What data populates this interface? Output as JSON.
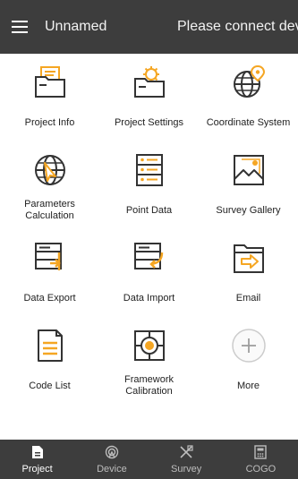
{
  "header": {
    "title": "Unnamed",
    "status": "Please connect device",
    "menu_icon": "hamburger-menu-icon"
  },
  "colors": {
    "accent": "#f5a623",
    "icon_stroke": "#333333",
    "bar_background": "#3d3d3d"
  },
  "tiles": [
    {
      "label": "Project Info",
      "icon": "folder-document-icon"
    },
    {
      "label": "Project Settings",
      "icon": "folder-gear-icon"
    },
    {
      "label": "Coordinate System",
      "icon": "globe-pin-icon"
    },
    {
      "label": "Parameters\nCalculation",
      "icon": "globe-cursor-icon"
    },
    {
      "label": "Point Data",
      "icon": "server-list-icon"
    },
    {
      "label": "Survey Gallery",
      "icon": "gallery-image-icon"
    },
    {
      "label": "Data Export",
      "icon": "export-drive-icon"
    },
    {
      "label": "Data Import",
      "icon": "import-drive-icon"
    },
    {
      "label": "Email",
      "icon": "folder-send-icon"
    },
    {
      "label": "Code List",
      "icon": "document-list-icon"
    },
    {
      "label": "Framework\nCalibration",
      "icon": "target-calibration-icon"
    },
    {
      "label": "More",
      "icon": "plus-circle-icon"
    }
  ],
  "nav": [
    {
      "label": "Project",
      "icon": "project-file-icon",
      "active": true
    },
    {
      "label": "Device",
      "icon": "device-antenna-icon",
      "active": false
    },
    {
      "label": "Survey",
      "icon": "survey-tools-icon",
      "active": false
    },
    {
      "label": "COGO",
      "icon": "calculator-icon",
      "active": false
    }
  ]
}
